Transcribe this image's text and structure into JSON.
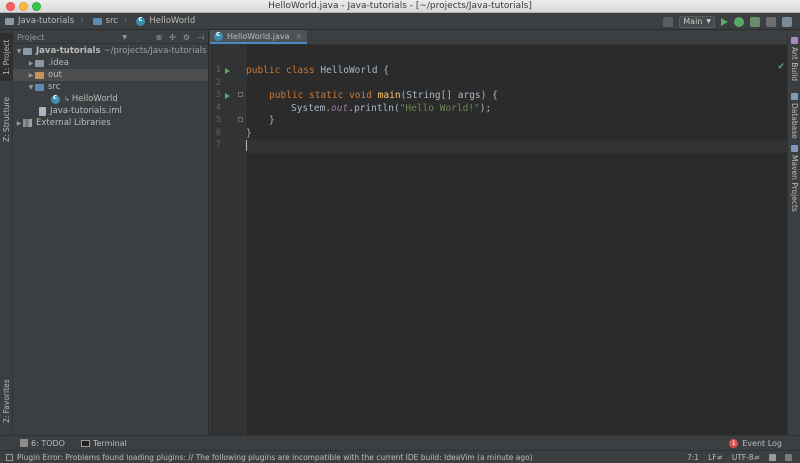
{
  "window": {
    "title": "HelloWorld.java - Java-tutorials - [~/projects/Java-tutorials]"
  },
  "breadcrumbs": [
    {
      "label": "Java-tutorials",
      "icon": "project-folder-icon"
    },
    {
      "label": "src",
      "icon": "source-folder-icon"
    },
    {
      "label": "HelloWorld",
      "icon": "java-class-icon"
    }
  ],
  "toolbar": {
    "run_config": "Main"
  },
  "left_tabs": {
    "project": "1: Project",
    "structure": "Z: Structure",
    "favorites": "2: Favorites"
  },
  "right_tabs": {
    "ant": "Ant Build",
    "database": "Database",
    "maven": "Maven Projects"
  },
  "project_panel": {
    "view_selector": "Project",
    "tree": {
      "root_name": "Java-tutorials",
      "root_path": "~/projects/Java-tutorials",
      "idea": ".idea",
      "out": "out",
      "src": "src",
      "helloworld": "HelloWorld",
      "iml": "Java-tutorials.iml",
      "external": "External Libraries"
    }
  },
  "editor": {
    "tab_label": "HelloWorld.java",
    "line_numbers": [
      "1",
      "2",
      "3",
      "4",
      "5",
      "6",
      "7"
    ],
    "tokens": {
      "l1_kw": "public class ",
      "l1_rest": "HelloWorld {",
      "l3_kw": "public static void ",
      "l3_fn": "main",
      "l3_rest": "(String[] args) {",
      "l4_sys": "System.",
      "l4_out": "out",
      "l4_call": ".println(",
      "l4_str": "\"Hello World!\"",
      "l4_end": ");",
      "l5": "}",
      "l6": "}"
    }
  },
  "bottom_tools": {
    "todo": "6: TODO",
    "terminal": "Terminal",
    "event_log": "Event Log",
    "event_count": "1"
  },
  "status_bar": {
    "message": "Plugin Error: Problems found loading plugins: // The following plugins are incompatible with the current IDE build: IdeaVim (a minute ago)",
    "position": "7:1",
    "line_sep": "LF≠",
    "encoding": "UTF-8≠"
  }
}
